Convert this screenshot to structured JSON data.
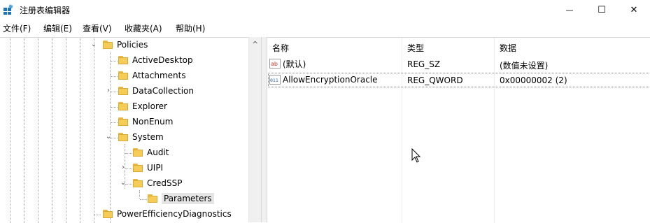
{
  "window": {
    "title": "注册表编辑器",
    "buttons": {
      "minimize": "—",
      "maximize": "☐",
      "close": "✕"
    }
  },
  "menu": [
    {
      "label": "文件(F)"
    },
    {
      "label": "编辑(E)"
    },
    {
      "label": "查看(V)"
    },
    {
      "label": "收藏夹(A)"
    },
    {
      "label": "帮助(H)"
    }
  ],
  "tree": {
    "items": [
      {
        "label": "Policies",
        "expander": "down"
      },
      {
        "label": "ActiveDesktop",
        "expander": ""
      },
      {
        "label": "Attachments",
        "expander": ""
      },
      {
        "label": "DataCollection",
        "expander": "right"
      },
      {
        "label": "Explorer",
        "expander": ""
      },
      {
        "label": "NonEnum",
        "expander": ""
      },
      {
        "label": "System",
        "expander": "down"
      },
      {
        "label": "Audit",
        "expander": ""
      },
      {
        "label": "UIPI",
        "expander": "right"
      },
      {
        "label": "CredSSP",
        "expander": "down"
      },
      {
        "label": "Parameters",
        "expander": "",
        "selected": true
      },
      {
        "label": "PowerEfficiencyDiagnostics",
        "expander": ""
      }
    ],
    "scroll_up_arrow": "^"
  },
  "list": {
    "columns": {
      "name": "名称",
      "type": "类型",
      "data": "数据"
    },
    "rows": [
      {
        "icon": "string-value-icon",
        "icon_text": "ab",
        "name": "(默认)",
        "type": "REG_SZ",
        "data": "(数值未设置)"
      },
      {
        "icon": "binary-value-icon",
        "icon_text": "011",
        "name": "AllowEncryptionOracle",
        "type": "REG_QWORD",
        "data": "0x00000002 (2)"
      }
    ]
  },
  "colors": {
    "folder": "#f5cd56",
    "selection": "#e5e5e5",
    "app_icon": "#1e73be"
  }
}
